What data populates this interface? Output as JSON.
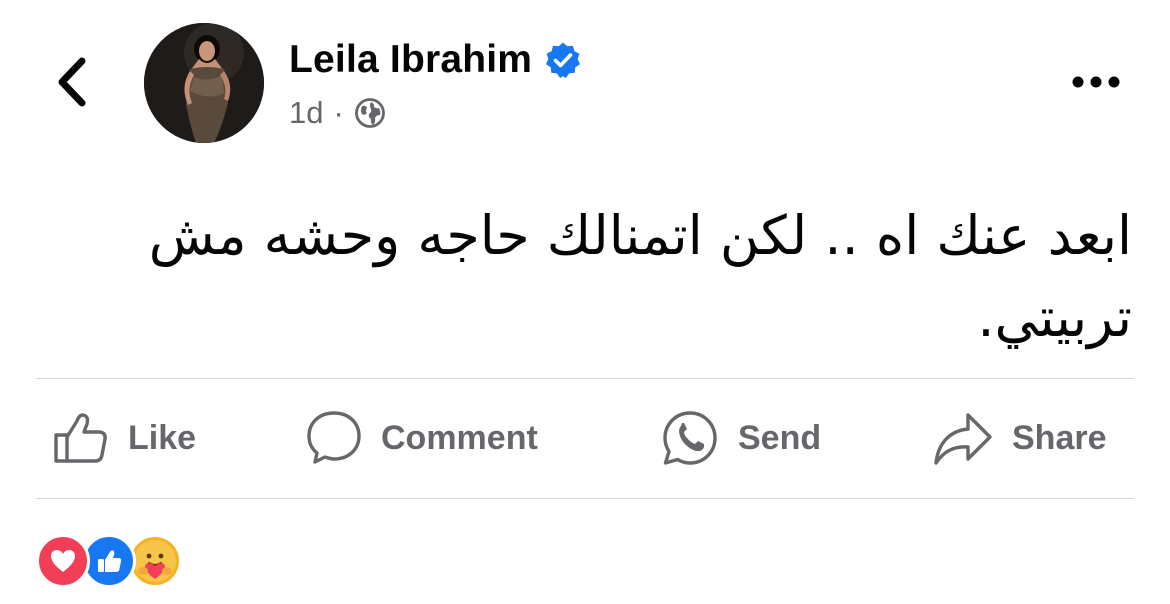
{
  "header": {
    "author_name": "Leila Ibrahim",
    "verified": true,
    "timestamp": "1d",
    "separator": "·",
    "privacy_icon": "globe-icon",
    "back_icon": "chevron-left-icon",
    "more_icon": "more-options-icon"
  },
  "post": {
    "text": "ابعد عنك اه .. لكن اتمنالك حاجه وحشه مش تربيتي."
  },
  "actions": [
    {
      "label": "Like",
      "icon": "like-icon"
    },
    {
      "label": "Comment",
      "icon": "comment-icon"
    },
    {
      "label": "Send",
      "icon": "whatsapp-send-icon"
    },
    {
      "label": "Share",
      "icon": "share-icon"
    }
  ],
  "reactions": [
    {
      "type": "love",
      "icon": "love-reaction-icon",
      "color": "#f33e58"
    },
    {
      "type": "like",
      "icon": "like-reaction-icon",
      "color": "#1877f2"
    },
    {
      "type": "care",
      "icon": "care-reaction-icon",
      "color": "#f7b125"
    }
  ],
  "colors": {
    "text_primary": "#050505",
    "text_secondary": "#65676b",
    "verified_blue": "#1877f2",
    "divider": "#d4d6da"
  }
}
